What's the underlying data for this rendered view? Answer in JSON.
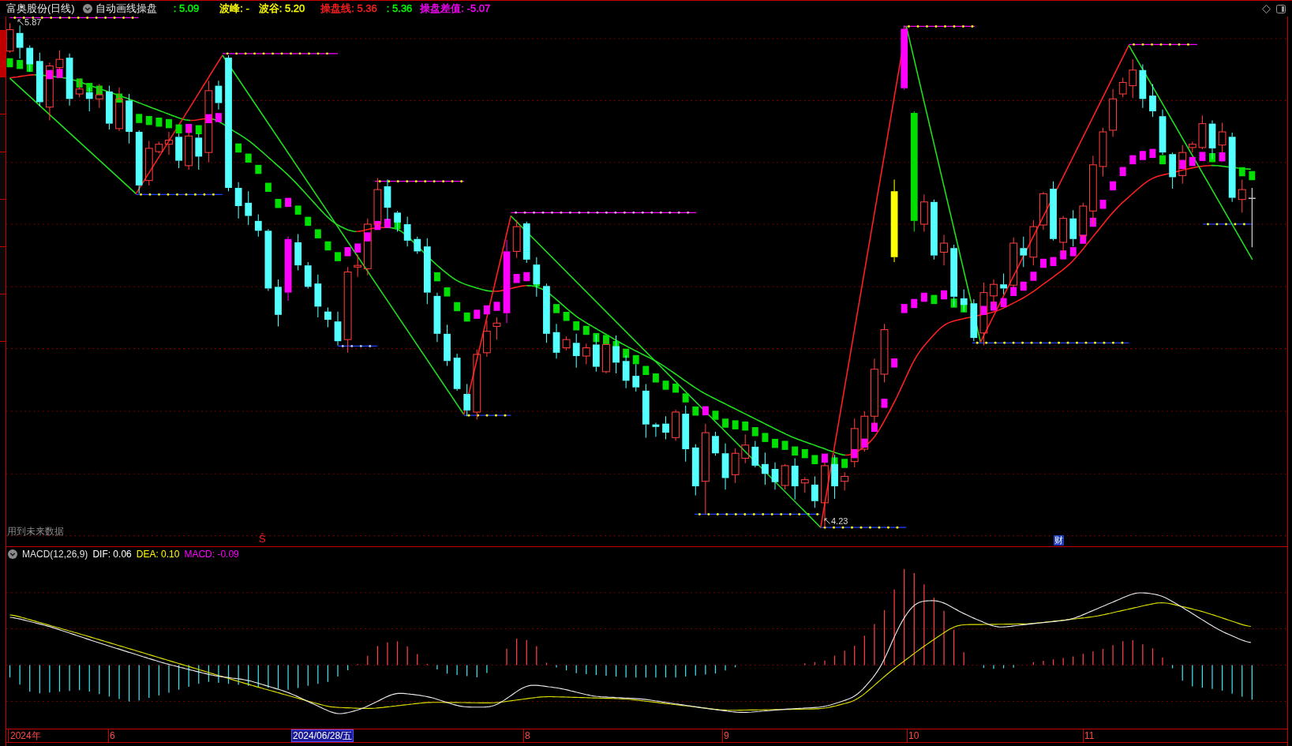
{
  "header": {
    "title": "富奥股份(日线)",
    "indicator": "自动画线操盘",
    "readings": [
      {
        "text": ": 5.09",
        "color": "#00ff00"
      },
      {
        "text": "波峰: -",
        "color": "#ffff00"
      },
      {
        "text": "波谷: 5.20",
        "color": "#ffff00"
      },
      {
        "text": "操盘线: 5.36",
        "color": "#ff2020"
      },
      {
        "text": ": 5.36",
        "color": "#00ff00"
      },
      {
        "text": "操盘差值: -5.07",
        "color": "#ff00ff"
      }
    ]
  },
  "side_tabs": [
    {
      "selected": true
    },
    {
      "selected": false
    },
    {
      "selected": false
    },
    {
      "selected": false
    },
    {
      "selected": false
    },
    {
      "selected": false
    },
    {
      "selected": false
    }
  ],
  "price_chart": {
    "high_label": "5.87",
    "low_label": "4.23",
    "notice": "用到未来数据",
    "signals": [
      {
        "kind": "sell",
        "text": "Ŝ"
      },
      {
        "kind": "finance",
        "text": "财"
      }
    ]
  },
  "macd": {
    "name": "MACD(12,26,9)",
    "readings": [
      {
        "text": "DIF: 0.06",
        "color": "#ffffff"
      },
      {
        "text": "DEA: 0.10",
        "color": "#ffff00"
      },
      {
        "text": "MACD: -0.09",
        "color": "#ff00ff"
      }
    ]
  },
  "time_axis": [
    {
      "text": "2024年",
      "kind": "month"
    },
    {
      "text": "6",
      "kind": "month"
    },
    {
      "text": "2024/06/28/五",
      "kind": "cursor"
    },
    {
      "text": "8",
      "kind": "month"
    },
    {
      "text": "9",
      "kind": "month"
    },
    {
      "text": "10",
      "kind": "month"
    },
    {
      "text": "11",
      "kind": "month"
    }
  ]
}
